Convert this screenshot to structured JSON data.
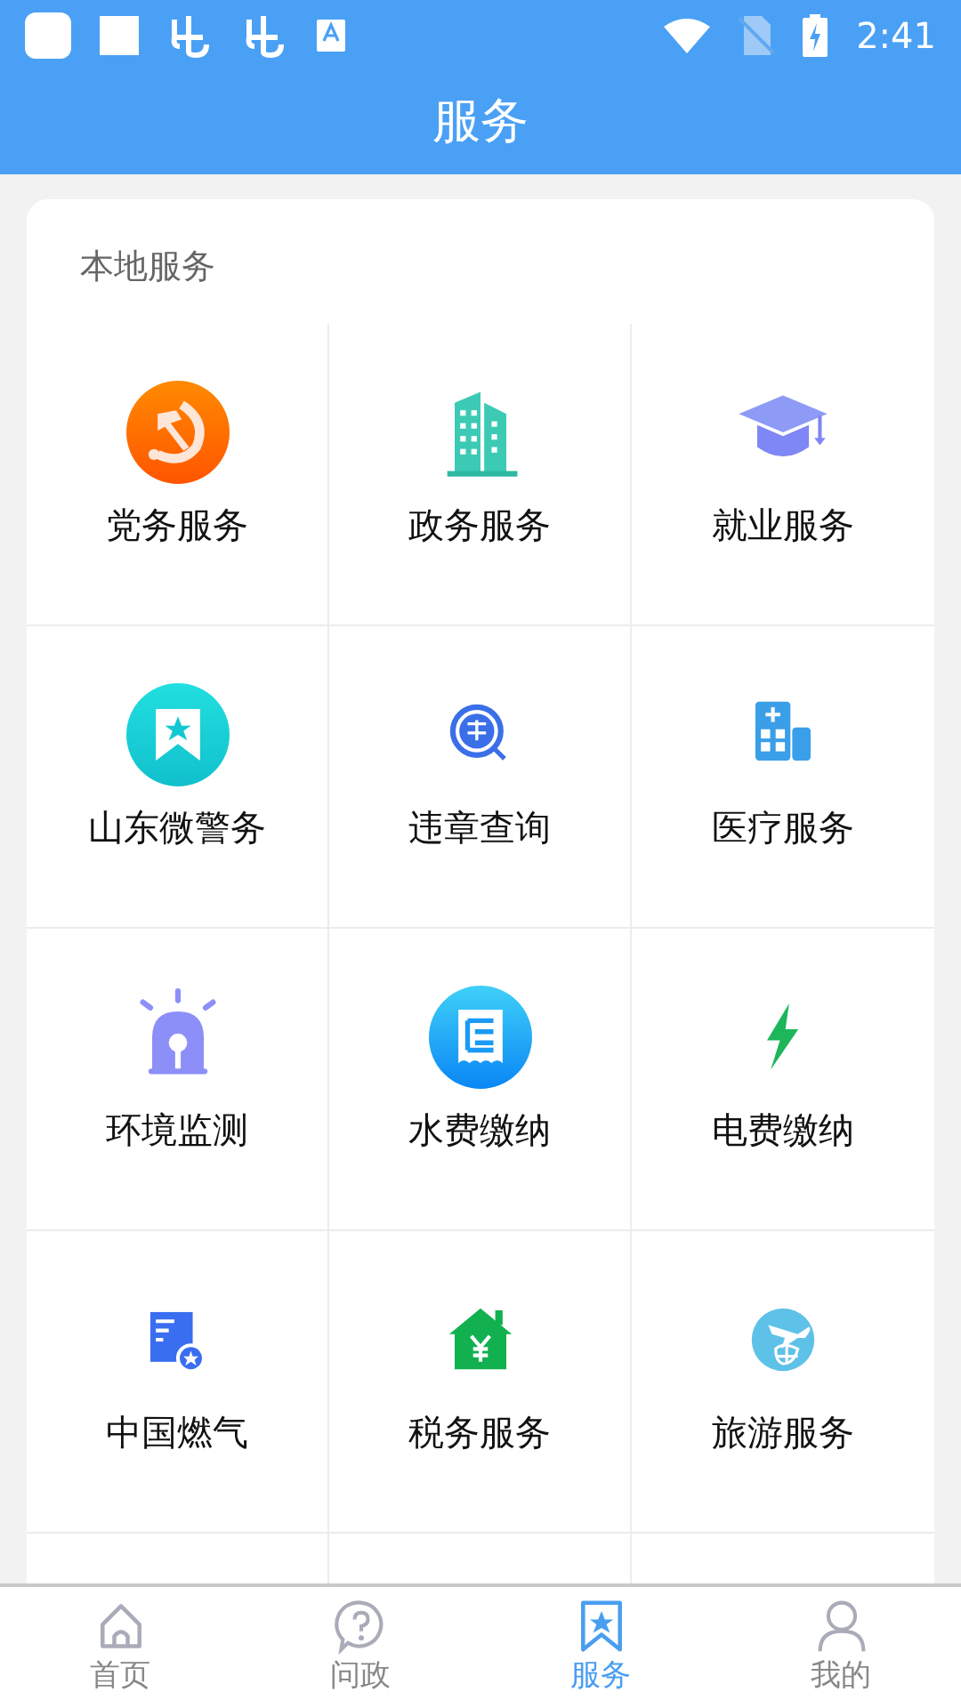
{
  "status_bar": {
    "time": "2:41"
  },
  "header": {
    "title": "服务"
  },
  "section": {
    "title": "本地服务",
    "items": [
      {
        "label": "党务服务"
      },
      {
        "label": "政务服务"
      },
      {
        "label": "就业服务"
      },
      {
        "label": "山东微警务"
      },
      {
        "label": "违章查询"
      },
      {
        "label": "医疗服务"
      },
      {
        "label": "环境监测"
      },
      {
        "label": "水费缴纳"
      },
      {
        "label": "电费缴纳"
      },
      {
        "label": "中国燃气"
      },
      {
        "label": "税务服务"
      },
      {
        "label": "旅游服务"
      }
    ]
  },
  "tab_bar": [
    {
      "label": "首页",
      "selected": false
    },
    {
      "label": "问政",
      "selected": false
    },
    {
      "label": "服务",
      "selected": true
    },
    {
      "label": "我的",
      "selected": false
    }
  ]
}
